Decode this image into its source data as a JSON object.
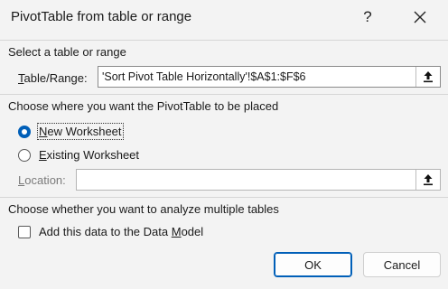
{
  "dialog": {
    "title": "PivotTable from table or range",
    "help_label": "?",
    "close_icon": "close-icon"
  },
  "select_section": {
    "heading": "Select a table or range",
    "range_label_accel": "T",
    "range_label_rest": "able/Range:",
    "range_value": "'Sort Pivot Table Horizontally'!$A$1:$F$6"
  },
  "placement_section": {
    "heading": "Choose where you want the PivotTable to be placed",
    "new_worksheet_accel": "N",
    "new_worksheet_rest": "ew Worksheet",
    "existing_worksheet_accel": "E",
    "existing_worksheet_rest": "xisting Worksheet",
    "location_label_accel": "L",
    "location_label_rest": "ocation:",
    "location_value": "",
    "selected": "new_worksheet"
  },
  "multiple_section": {
    "heading": "Choose whether you want to analyze multiple tables",
    "data_model_label_pre": "Add this data to the Data ",
    "data_model_label_accel": "M",
    "data_model_label_post": "odel",
    "data_model_checked": false
  },
  "buttons": {
    "ok_label": "OK",
    "cancel_label": "Cancel"
  }
}
